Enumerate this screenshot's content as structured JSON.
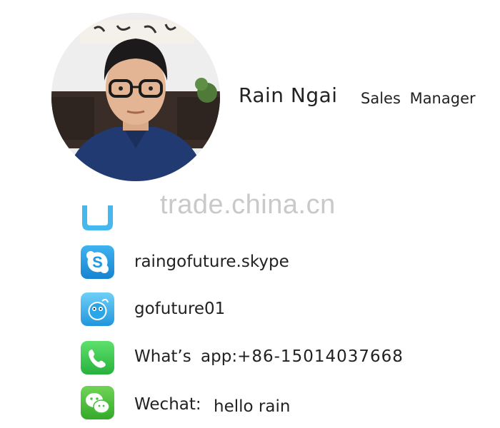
{
  "profile": {
    "name": "Rain Ngai",
    "title": "Sales  Manager"
  },
  "watermark": "trade.china.cn",
  "contacts": {
    "skype": {
      "icon": "skype-icon",
      "value": "raingofuture.skype"
    },
    "qq": {
      "icon": "qq-icon",
      "value": "gofuture01"
    },
    "whatsapp": {
      "icon": "whatsapp-icon",
      "label": "What’s  app:",
      "value": "+86-15014037668"
    },
    "wechat": {
      "icon": "wechat-icon",
      "label": "Wechat:",
      "value": "hello rain"
    }
  },
  "colors": {
    "skype_blue": "#1e9be0",
    "qq_blue": "#2aa6e6",
    "whatsapp_green": "#39c253",
    "wechat_green": "#45c13b",
    "watermark_gray": "#c9c9c9"
  }
}
